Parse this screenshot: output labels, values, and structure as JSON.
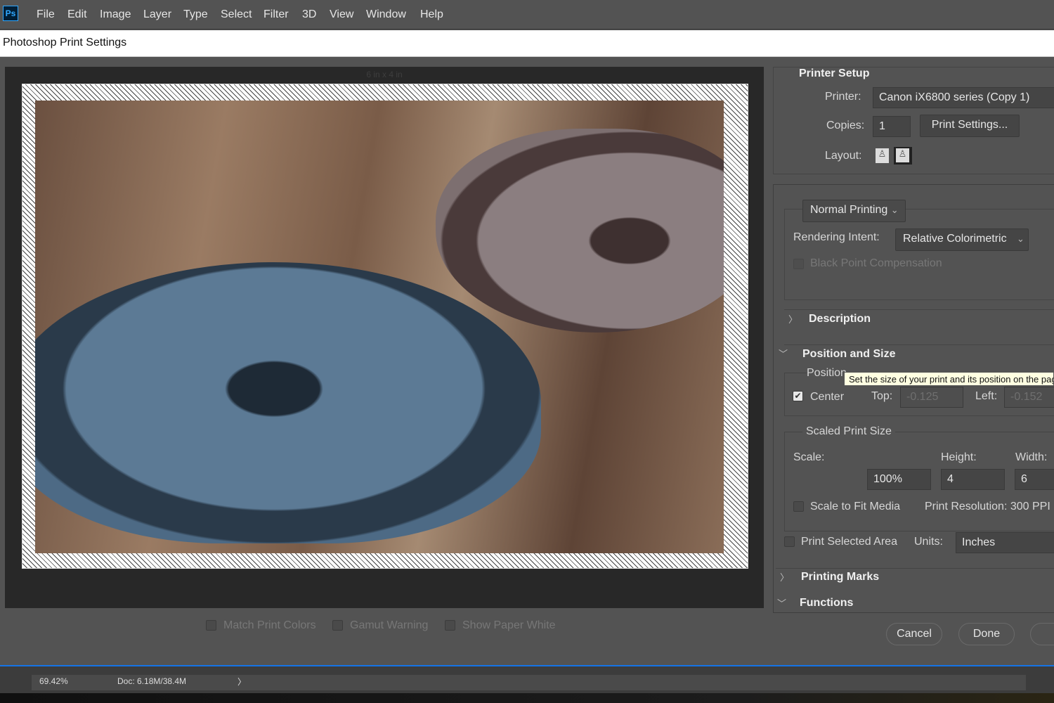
{
  "app": {
    "logo": "Ps",
    "menu": [
      "File",
      "Edit",
      "Image",
      "Layer",
      "Type",
      "Select",
      "Filter",
      "3D",
      "View",
      "Window",
      "Help"
    ]
  },
  "dialog": {
    "title": "Photoshop Print Settings"
  },
  "preview": {
    "size_label": "6 in x 4 in",
    "options": [
      "Match Print Colors",
      "Gamut Warning",
      "Show Paper White"
    ]
  },
  "printer_setup": {
    "heading": "Printer Setup",
    "printer_label": "Printer:",
    "printer": "Canon iX6800 series (Copy 1)",
    "copies_label": "Copies:",
    "copies": "1",
    "print_settings": "Print Settings...",
    "layout_label": "Layout:"
  },
  "color": {
    "mode": "Normal Printing",
    "rendering_label": "Rendering Intent:",
    "rendering": "Relative Colorimetric",
    "bpc": "Black Point Compensation"
  },
  "description": {
    "heading": "Description"
  },
  "position_size": {
    "heading": "Position and Size",
    "position_label": "Position",
    "tooltip": "Set the size of your print and its position on the page",
    "center": "Center",
    "center_checked": true,
    "top_label": "Top:",
    "top": "-0.125",
    "left_label": "Left:",
    "left": "-0.152",
    "scaled_heading": "Scaled Print Size",
    "scale_label": "Scale:",
    "height_label": "Height:",
    "width_label": "Width:",
    "scale": "100%",
    "height": "4",
    "width": "6",
    "fit_media": "Scale to Fit Media",
    "resolution": "Print Resolution: 300 PPI",
    "print_selected": "Print Selected Area",
    "units_label": "Units:",
    "units": "Inches"
  },
  "printing_marks": {
    "heading": "Printing Marks"
  },
  "functions": {
    "heading": "Functions"
  },
  "buttons": {
    "cancel": "Cancel",
    "done": "Done"
  },
  "status": {
    "zoom": "69.42%",
    "doc": "Doc: 6.18M/38.4M",
    "arrow": "〉"
  }
}
